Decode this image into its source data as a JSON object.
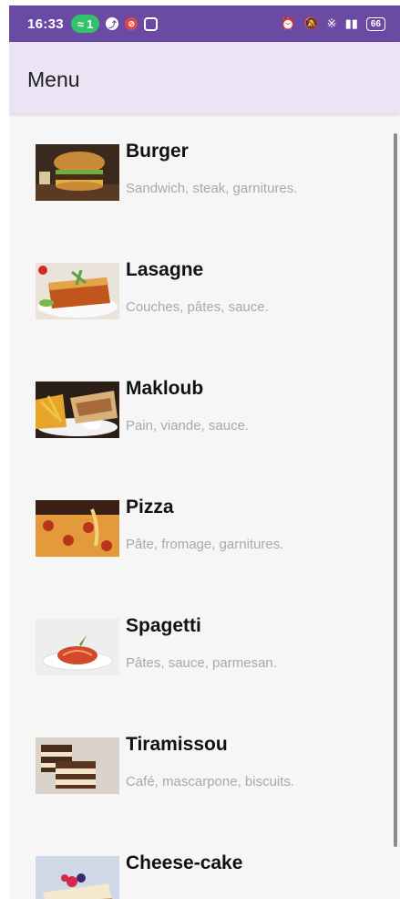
{
  "status_bar": {
    "time": "16:33",
    "hotspot_count": "1",
    "battery": "66",
    "icons": [
      "messenger-icon",
      "blocked-icon",
      "instagram-icon",
      "alarm-icon",
      "mute-icon",
      "bluetooth-icon",
      "signal-icon",
      "battery-icon"
    ]
  },
  "toolbar": {
    "title": "Menu"
  },
  "menu": {
    "items": [
      {
        "name": "Burger",
        "description": "Sandwich, steak, garnitures."
      },
      {
        "name": "Lasagne",
        "description": "Couches, pâtes, sauce."
      },
      {
        "name": "Makloub",
        "description": "Pain, viande, sauce."
      },
      {
        "name": "Pizza",
        "description": "Pâte, fromage, garnitures."
      },
      {
        "name": "Spagetti",
        "description": "Pâtes, sauce, parmesan."
      },
      {
        "name": "Tiramissou",
        "description": "Café, mascarpone, biscuits."
      },
      {
        "name": "Cheese-cake",
        "description": ""
      }
    ]
  },
  "colors": {
    "status_bar": "#6a4aa3",
    "toolbar": "#eae4f4",
    "list_background": "#f6f6f6",
    "description_text": "#a9a9a9"
  }
}
